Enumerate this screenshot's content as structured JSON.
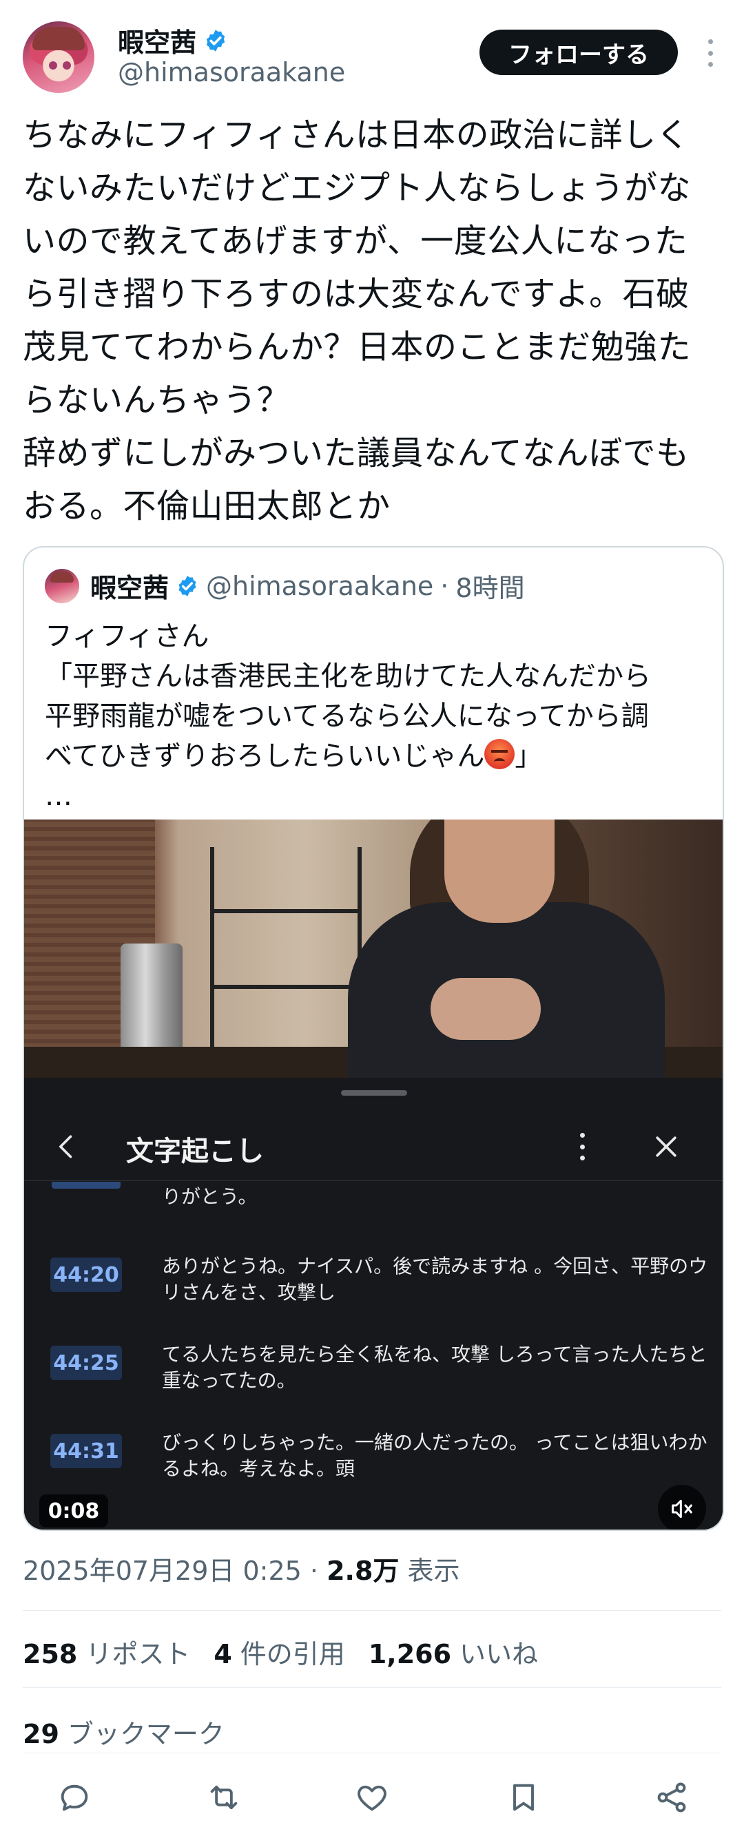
{
  "author": {
    "display_name": "暇空茜",
    "handle": "@himasoraakane"
  },
  "follow_label": "フォローする",
  "tweet_text": "ちなみにフィフィさんは日本の政治に詳しく\nないみたいだけどエジプト人ならしょうがな\nいので教えてあげますが、一度公人になった\nら引き摺り下ろすのは大変なんですよ。石破\n茂見ててわからんか？日本のことまだ勉強た\nらないんちゃう？\n辞めずにしがみついた議員なんてなんぼでも\nおる。不倫山田太郎とか",
  "quote": {
    "display_name": "暇空茜",
    "handle": "@himasoraakane",
    "time_sep": " · ",
    "time": "8時間",
    "text_main": "フィフィさん\n「平野さんは香港民主化を助けてた人なんだから\n平野雨龍が嘘をついてるなら公人になってから調\nべてひきずりおろしたらいいじゃん",
    "text_end": "」",
    "ellipsis": "…",
    "emoji": "angry-face"
  },
  "transcript": {
    "title": "文字起こし",
    "partial_line": "りがとう。",
    "rows": [
      {
        "time": "44:20",
        "text": "ありがとうね。ナイスパ。後で読みますね 。今回さ、平野のウリさんをさ、攻撃し"
      },
      {
        "time": "44:25",
        "text": "てる人たちを見たら全く私をね、攻撃 しろって言った人たちと重なってたの。"
      },
      {
        "time": "44:31",
        "text": "びっくりしちゃった。一緒の人だったの。 ってことは狙いわかるよね。考えなよ。頭"
      }
    ],
    "elapsed": "0:08"
  },
  "meta": {
    "datetime": "2025年07月29日 0:25",
    "sep": " · ",
    "views": "2.8万",
    "views_label": " 表示"
  },
  "stats": {
    "reposts": "258",
    "reposts_label": "リポスト",
    "quotes": "4",
    "quotes_label": "件の引用",
    "likes": "1,266",
    "likes_label": "いいね",
    "bookmarks": "29",
    "bookmarks_label": "ブックマーク"
  },
  "colors": {
    "verified": "#1d9bf0",
    "text": "#0f1419",
    "muted": "#536471",
    "timestamp_link": "#8ab4f8"
  },
  "icons": [
    "verified-badge-icon",
    "more-icon",
    "back-icon",
    "kebab-icon",
    "close-icon",
    "mute-icon",
    "reply-icon",
    "repost-icon",
    "like-icon",
    "bookmark-icon",
    "share-icon"
  ]
}
